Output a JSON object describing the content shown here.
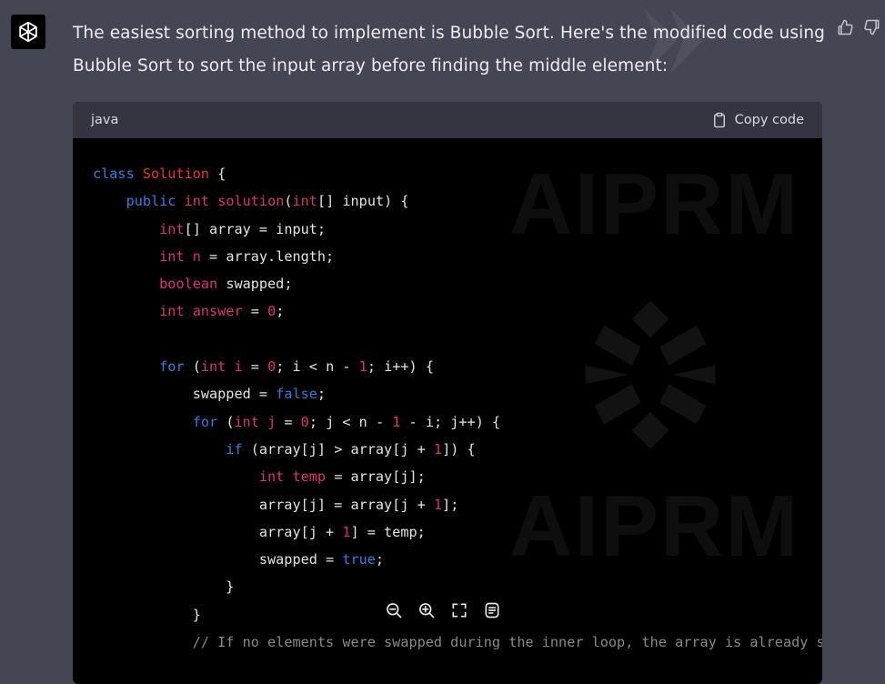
{
  "assistant": {
    "message": "The easiest sorting method to implement is Bubble Sort. Here's the modified code using Bubble Sort to sort the input array before finding the middle element:"
  },
  "code_block": {
    "language": "java",
    "copy_label": "Copy code",
    "lines": [
      [
        {
          "t": "class ",
          "c": "kw"
        },
        {
          "t": "Solution",
          "c": "cl"
        },
        {
          "t": " {",
          "c": ""
        }
      ],
      [
        {
          "t": "    ",
          "c": ""
        },
        {
          "t": "public",
          "c": "kw"
        },
        {
          "t": " ",
          "c": ""
        },
        {
          "t": "int",
          "c": "ty"
        },
        {
          "t": " ",
          "c": ""
        },
        {
          "t": "solution",
          "c": "nm"
        },
        {
          "t": "(",
          "c": ""
        },
        {
          "t": "int",
          "c": "ty"
        },
        {
          "t": "[] input) {",
          "c": ""
        }
      ],
      [
        {
          "t": "        ",
          "c": ""
        },
        {
          "t": "int",
          "c": "ty"
        },
        {
          "t": "[] array = input;",
          "c": ""
        }
      ],
      [
        {
          "t": "        ",
          "c": ""
        },
        {
          "t": "int",
          "c": "ty"
        },
        {
          "t": " ",
          "c": ""
        },
        {
          "t": "n",
          "c": "nm"
        },
        {
          "t": " = array.length;",
          "c": ""
        }
      ],
      [
        {
          "t": "        ",
          "c": ""
        },
        {
          "t": "boolean",
          "c": "ty"
        },
        {
          "t": " swapped;",
          "c": ""
        }
      ],
      [
        {
          "t": "        ",
          "c": ""
        },
        {
          "t": "int",
          "c": "ty"
        },
        {
          "t": " ",
          "c": ""
        },
        {
          "t": "answer",
          "c": "nm"
        },
        {
          "t": " = ",
          "c": ""
        },
        {
          "t": "0",
          "c": "num"
        },
        {
          "t": ";",
          "c": ""
        }
      ],
      [
        {
          "t": "",
          "c": ""
        }
      ],
      [
        {
          "t": "        ",
          "c": ""
        },
        {
          "t": "for",
          "c": "kw"
        },
        {
          "t": " (",
          "c": ""
        },
        {
          "t": "int",
          "c": "ty"
        },
        {
          "t": " ",
          "c": ""
        },
        {
          "t": "i",
          "c": "nm"
        },
        {
          "t": " = ",
          "c": ""
        },
        {
          "t": "0",
          "c": "num"
        },
        {
          "t": "; i < n - ",
          "c": ""
        },
        {
          "t": "1",
          "c": "num"
        },
        {
          "t": "; i++) {",
          "c": ""
        }
      ],
      [
        {
          "t": "            swapped = ",
          "c": ""
        },
        {
          "t": "false",
          "c": "kw"
        },
        {
          "t": ";",
          "c": ""
        }
      ],
      [
        {
          "t": "            ",
          "c": ""
        },
        {
          "t": "for",
          "c": "kw"
        },
        {
          "t": " (",
          "c": ""
        },
        {
          "t": "int",
          "c": "ty"
        },
        {
          "t": " ",
          "c": ""
        },
        {
          "t": "j",
          "c": "nm"
        },
        {
          "t": " = ",
          "c": ""
        },
        {
          "t": "0",
          "c": "num"
        },
        {
          "t": "; j < n - ",
          "c": ""
        },
        {
          "t": "1",
          "c": "num"
        },
        {
          "t": " - i; j++) {",
          "c": ""
        }
      ],
      [
        {
          "t": "                ",
          "c": ""
        },
        {
          "t": "if",
          "c": "kw"
        },
        {
          "t": " (array[j] > array[j + ",
          "c": ""
        },
        {
          "t": "1",
          "c": "num"
        },
        {
          "t": "]) {",
          "c": ""
        }
      ],
      [
        {
          "t": "                    ",
          "c": ""
        },
        {
          "t": "int",
          "c": "ty"
        },
        {
          "t": " ",
          "c": ""
        },
        {
          "t": "temp",
          "c": "nm"
        },
        {
          "t": " = array[j];",
          "c": ""
        }
      ],
      [
        {
          "t": "                    array[j] = array[j + ",
          "c": ""
        },
        {
          "t": "1",
          "c": "num"
        },
        {
          "t": "];",
          "c": ""
        }
      ],
      [
        {
          "t": "                    array[j + ",
          "c": ""
        },
        {
          "t": "1",
          "c": "num"
        },
        {
          "t": "] = temp;",
          "c": ""
        }
      ],
      [
        {
          "t": "                    swapped = ",
          "c": ""
        },
        {
          "t": "true",
          "c": "kw"
        },
        {
          "t": ";",
          "c": ""
        }
      ],
      [
        {
          "t": "                }",
          "c": ""
        }
      ],
      [
        {
          "t": "            }",
          "c": ""
        }
      ],
      [
        {
          "t": "            ",
          "c": ""
        },
        {
          "t": "// If no elements were swapped during the inner loop, the array is already s",
          "c": "cm"
        }
      ]
    ]
  },
  "watermark": {
    "text_top": "AIPRM",
    "text_bottom": "AIPRM"
  },
  "icons": {
    "avatar": "openai-logo-icon",
    "thumbs_up": "thumbs-up-icon",
    "thumbs_down": "thumbs-down-icon",
    "copy": "clipboard-icon",
    "zoom_out": "zoom-out-icon",
    "zoom_in": "zoom-in-icon",
    "fullscreen": "fullscreen-icon",
    "notes": "notes-icon"
  },
  "colors": {
    "page_bg": "#444654",
    "code_bg": "#000000",
    "code_header_bg": "#343541",
    "keyword": "#2f7fe0",
    "type": "#df3079",
    "class_name": "#f22c3d",
    "comment": "#8a8a8a"
  }
}
